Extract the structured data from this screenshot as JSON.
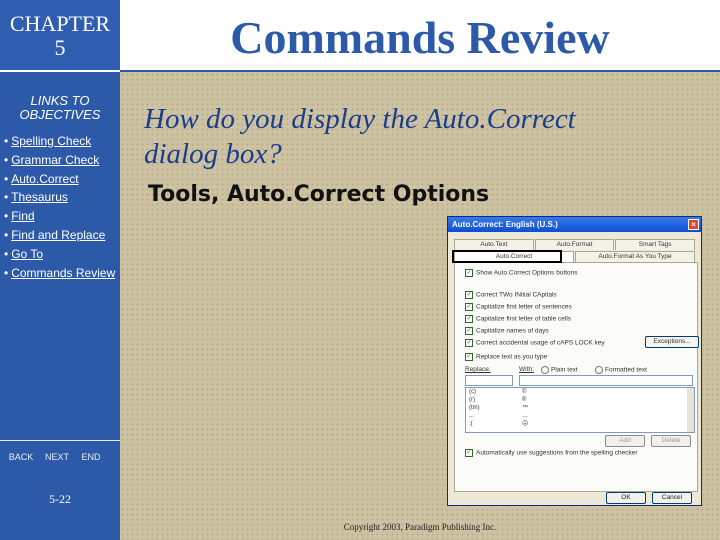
{
  "sidebar": {
    "chapter_label": "CHAPTER",
    "chapter_number": "5",
    "links_title_line1": "LINKS TO",
    "links_title_line2": "OBJECTIVES",
    "links": [
      "Spelling Check",
      "Grammar Check",
      "Auto.Correct",
      "Thesaurus",
      "Find",
      "Find and Replace",
      "Go To",
      "Commands Review"
    ],
    "bullet": "•",
    "nav": {
      "back": "BACK",
      "next": "NEXT",
      "end": "END"
    },
    "page_number": "5-22"
  },
  "slide": {
    "title": "Commands Review",
    "question_line1": "How do you display the Auto.Correct",
    "question_line2": "dialog box?",
    "answer": "Tools, Auto.Correct Options",
    "copyright": "Copyright 2003, Paradigm Publishing Inc."
  },
  "dialog": {
    "title": "Auto.Correct: English (U.S.)",
    "close_glyph": "×",
    "tabs_row1": [
      "Auto.Text",
      "Auto.Format",
      "Smart Tags"
    ],
    "tabs_row2": [
      "Auto.Correct",
      "Auto.Format As You Type"
    ],
    "options": [
      {
        "label": "Show Auto.Correct Options buttons",
        "checked": true
      },
      {
        "label": "Correct TWo INitial CApitals",
        "checked": true
      },
      {
        "label": "Capitalize first letter of sentences",
        "checked": true
      },
      {
        "label": "Capitalize first letter of table cells",
        "checked": true
      },
      {
        "label": "Capitalize names of days",
        "checked": true
      },
      {
        "label": "Correct accidental usage of cAPS LOCK key",
        "checked": true
      },
      {
        "label": "Replace text as you type",
        "checked": true
      }
    ],
    "check_glyph": "✓",
    "exceptions_button": "Exceptions...",
    "replace_label": "Replace:",
    "with_label": "With:",
    "plain_text": "Plain text",
    "formatted_text": "Formatted text",
    "entries": [
      {
        "key": "(c)",
        "value": "©"
      },
      {
        "key": "(r)",
        "value": "®"
      },
      {
        "key": "(tm)",
        "value": "™"
      },
      {
        "key": "...",
        "value": "…"
      },
      {
        "key": ":(",
        "value": "☹"
      }
    ],
    "add_button": "Add",
    "delete_button": "Delete",
    "auto_suggest": "Automatically use suggestions from the spelling checker",
    "ok_button": "OK",
    "cancel_button": "Cancel"
  }
}
